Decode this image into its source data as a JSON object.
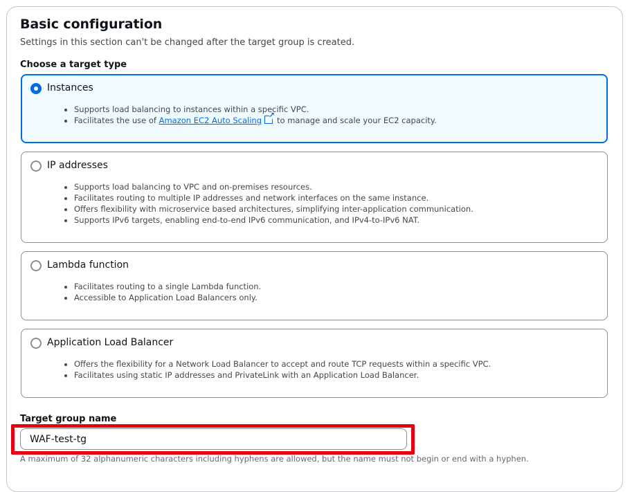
{
  "section": {
    "title": "Basic configuration",
    "description": "Settings in this section can't be changed after the target group is created."
  },
  "target_type": {
    "label": "Choose a target type",
    "selected": "instances",
    "options": [
      {
        "id": "instances",
        "label": "Instances",
        "bullets": [
          "Supports load balancing to instances within a specific VPC.",
          "Facilitates the use of"
        ],
        "link_text": "Amazon EC2 Auto Scaling",
        "link_icon": "external-link-icon",
        "link_suffix": "to manage and scale your EC2 capacity."
      },
      {
        "id": "ip",
        "label": "IP addresses",
        "bullets": [
          "Supports load balancing to VPC and on-premises resources.",
          "Facilitates routing to multiple IP addresses and network interfaces on the same instance.",
          "Offers flexibility with microservice based architectures, simplifying inter-application communication.",
          "Supports IPv6 targets, enabling end-to-end IPv6 communication, and IPv4-to-IPv6 NAT."
        ]
      },
      {
        "id": "lambda",
        "label": "Lambda function",
        "bullets": [
          "Facilitates routing to a single Lambda function.",
          "Accessible to Application Load Balancers only."
        ]
      },
      {
        "id": "alb",
        "label": "Application Load Balancer",
        "bullets": [
          "Offers the flexibility for a Network Load Balancer to accept and route TCP requests within a specific VPC.",
          "Facilitates using static IP addresses and PrivateLink with an Application Load Balancer."
        ]
      }
    ]
  },
  "target_group_name": {
    "label": "Target group name",
    "value": "WAF-test-tg",
    "hint": "A maximum of 32 alphanumeric characters including hyphens are allowed, but the name must not begin or end with a hyphen."
  },
  "colors": {
    "accent": "#006ce0",
    "selected_bg": "#f0fbff",
    "highlight": "#e60012",
    "border": "#8c8c94"
  }
}
